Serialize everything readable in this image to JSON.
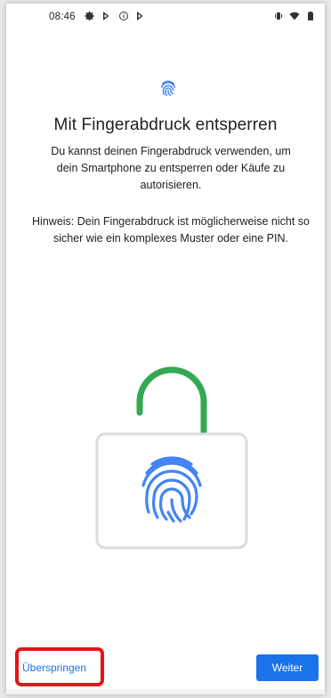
{
  "status_bar": {
    "time": "08:46",
    "left_icons": [
      "settings-icon",
      "play-store-icon",
      "info-icon",
      "play-store-icon"
    ],
    "right_icons": [
      "vibrate-icon",
      "wifi-icon",
      "battery-icon"
    ]
  },
  "main": {
    "title": "Mit Fingerabdruck entsperren",
    "description": "Du kannst deinen Fingerabdruck verwenden, um dein Smartphone zu entsperren oder Käufe zu autorisieren.",
    "note": "Hinweis: Dein Fingerabdruck ist möglicherweise nicht so sicher wie ein komplexes Muster oder eine PIN."
  },
  "illustration": {
    "icon": "unlocked-padlock-fingerprint",
    "shackle_color": "#34a853",
    "fingerprint_color": "#4285f4",
    "body_border_color": "#dadce0"
  },
  "footer": {
    "skip_label": "Überspringen",
    "next_label": "Weiter",
    "accent_color": "#1a73e8",
    "highlight_color": "#e4141a"
  }
}
